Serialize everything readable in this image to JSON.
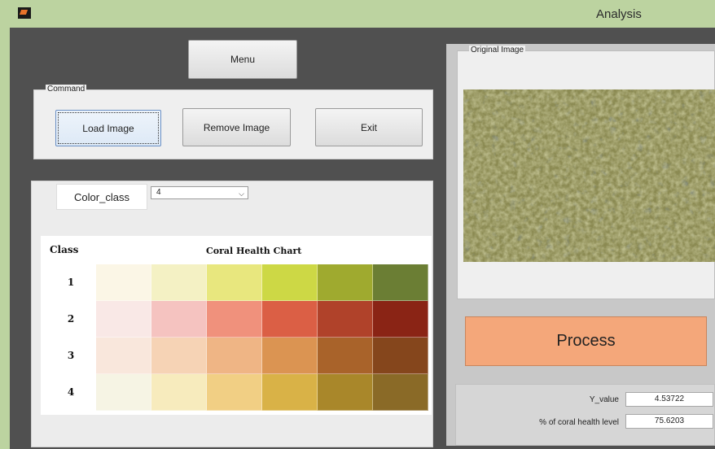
{
  "window": {
    "title": "Analysis"
  },
  "buttons": {
    "menu": "Menu"
  },
  "command": {
    "title": "Command",
    "load": "Load Image",
    "remove": "Remove Image",
    "exit": "Exit"
  },
  "color_class": {
    "label": "Color_class",
    "selected": "4"
  },
  "health_chart": {
    "class_header": "Class",
    "title": "Coral Health Chart",
    "rows": [
      {
        "label": "1",
        "colors": [
          "#fbf6e6",
          "#f4f1c4",
          "#e8e77e",
          "#cdd845",
          "#9faa2f",
          "#6b7e34"
        ]
      },
      {
        "label": "2",
        "colors": [
          "#f9e8e6",
          "#f5c3c0",
          "#f0917c",
          "#db5f45",
          "#b0422a",
          "#8a2415"
        ]
      },
      {
        "label": "3",
        "colors": [
          "#f9e7dc",
          "#f6d3b5",
          "#efb585",
          "#db9452",
          "#a9632a",
          "#85461c"
        ]
      },
      {
        "label": "4",
        "colors": [
          "#f6f4e4",
          "#f7ebbd",
          "#f1cf84",
          "#d9b247",
          "#a9872a",
          "#8a6a27"
        ]
      }
    ]
  },
  "original_image": {
    "title": "Original Image"
  },
  "process": {
    "label": "Process"
  },
  "results": {
    "y_label": "Y_value",
    "y_value": "4.53722",
    "pct_label": "% of coral health level",
    "pct_value": "75.6203"
  },
  "colors": {
    "accent": "#f4a77a",
    "titlebar": "#bcd3a0"
  }
}
